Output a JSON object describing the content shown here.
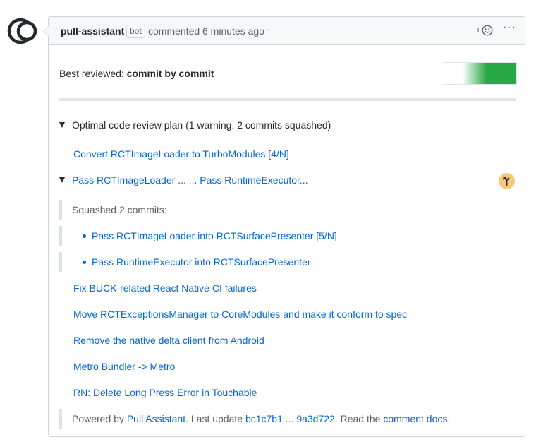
{
  "comment": {
    "author": "pull-assistant",
    "badge": "bot",
    "action": "commented",
    "time": "6 minutes ago",
    "dot": "·",
    "reaction_label": "+",
    "menu_label": "···"
  },
  "review": {
    "best_label": "Best reviewed:",
    "best_value": "commit by commit",
    "progress_fraction": 0.72,
    "progress_color": "#28a745"
  },
  "plan": {
    "title": "Optimal code review plan (1 warning, 2 commits squashed)",
    "commits": [
      "Convert RCTImageLoader to TurboModules [4/N]",
      "Pass RCTImageLoader ... ... Pass RuntimeExecutor...",
      "Fix BUCK-related React Native CI failures",
      "Move RCTExceptionsManager to CoreModules and make it conform to spec",
      "Remove the native delta client from Android",
      "Metro Bundler -> Metro",
      "RN: Delete Long Press Error in Touchable"
    ],
    "squashed_label": "Squashed 2 commits:",
    "squashed": [
      "Pass RCTImageLoader into RCTSurfacePresenter [5/N]",
      "Pass RuntimeExecutor into RCTSurfacePresenter"
    ],
    "warning_icon_color": "#f9c77c"
  },
  "footer": {
    "powered_by": "Powered by",
    "tool": "Pull Assistant",
    "last_update": ". Last update",
    "from_sha": "bc1c7b1",
    "ellipsis": "...",
    "to_sha": "9a3d722",
    "read_the": ". Read the",
    "docs_link": "comment docs",
    "end": "."
  }
}
